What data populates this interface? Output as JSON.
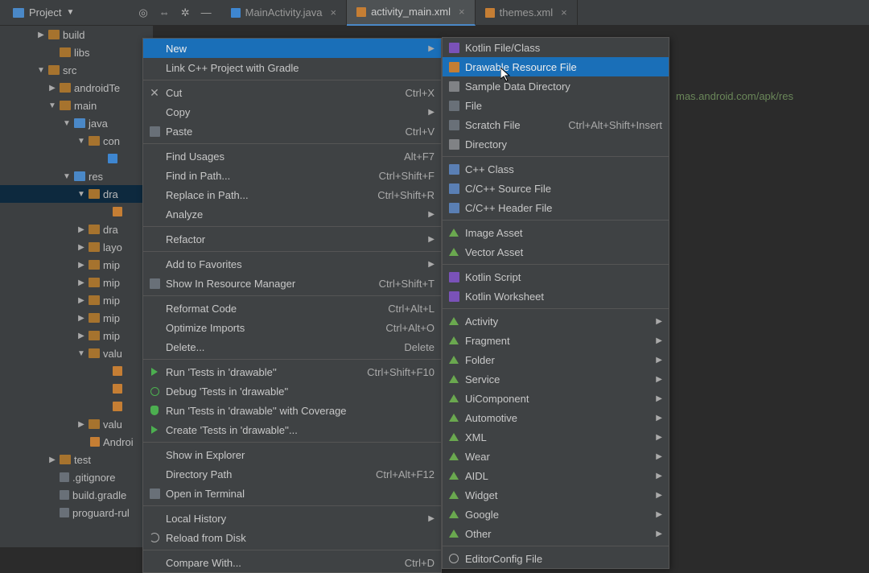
{
  "topbar": {
    "project_label": "Project",
    "tabs": [
      {
        "label": "MainActivity.java",
        "icon": "java"
      },
      {
        "label": "activity_main.xml",
        "icon": "xml",
        "active": true
      },
      {
        "label": "themes.xml",
        "icon": "xml"
      }
    ]
  },
  "tree": {
    "items": [
      {
        "label": "build",
        "indent": 46,
        "arrow": "▶",
        "icon": "folder"
      },
      {
        "label": "libs",
        "indent": 60,
        "arrow": "",
        "icon": "folder"
      },
      {
        "label": "src",
        "indent": 46,
        "arrow": "▼",
        "icon": "folder"
      },
      {
        "label": "androidTe",
        "indent": 60,
        "arrow": "▶",
        "icon": "folder"
      },
      {
        "label": "main",
        "indent": 60,
        "arrow": "▼",
        "icon": "folder"
      },
      {
        "label": "java",
        "indent": 78,
        "arrow": "▼",
        "icon": "folder-blue"
      },
      {
        "label": "con",
        "indent": 96,
        "arrow": "▼",
        "icon": "folder"
      },
      {
        "label": "",
        "indent": 120,
        "arrow": "",
        "icon": "java"
      },
      {
        "label": "res",
        "indent": 78,
        "arrow": "▼",
        "icon": "folder-blue"
      },
      {
        "label": "dra",
        "indent": 96,
        "arrow": "▼",
        "icon": "folder",
        "sel": true
      },
      {
        "label": "",
        "indent": 126,
        "arrow": "",
        "icon": "xml"
      },
      {
        "label": "dra",
        "indent": 96,
        "arrow": "▶",
        "icon": "folder"
      },
      {
        "label": "layo",
        "indent": 96,
        "arrow": "▶",
        "icon": "folder"
      },
      {
        "label": "mip",
        "indent": 96,
        "arrow": "▶",
        "icon": "folder"
      },
      {
        "label": "mip",
        "indent": 96,
        "arrow": "▶",
        "icon": "folder"
      },
      {
        "label": "mip",
        "indent": 96,
        "arrow": "▶",
        "icon": "folder"
      },
      {
        "label": "mip",
        "indent": 96,
        "arrow": "▶",
        "icon": "folder"
      },
      {
        "label": "mip",
        "indent": 96,
        "arrow": "▶",
        "icon": "folder"
      },
      {
        "label": "valu",
        "indent": 96,
        "arrow": "▼",
        "icon": "folder"
      },
      {
        "label": "",
        "indent": 126,
        "arrow": "",
        "icon": "xml"
      },
      {
        "label": "",
        "indent": 126,
        "arrow": "",
        "icon": "xml"
      },
      {
        "label": "",
        "indent": 126,
        "arrow": "",
        "icon": "xml"
      },
      {
        "label": "valu",
        "indent": 96,
        "arrow": "▶",
        "icon": "folder"
      },
      {
        "label": "Androi",
        "indent": 98,
        "arrow": "",
        "icon": "xml"
      },
      {
        "label": "test",
        "indent": 60,
        "arrow": "▶",
        "icon": "folder"
      },
      {
        "label": ".gitignore",
        "indent": 60,
        "arrow": "",
        "icon": "file"
      },
      {
        "label": "build.gradle",
        "indent": 60,
        "arrow": "",
        "icon": "file"
      },
      {
        "label": "proguard-rul",
        "indent": 60,
        "arrow": "",
        "icon": "file"
      }
    ]
  },
  "editor": {
    "bg_line": "mas.android.com/apk/res"
  },
  "menu1": {
    "items": [
      {
        "label": "New",
        "sub": true,
        "sel": true
      },
      {
        "label": "Link C++ Project with Gradle"
      },
      {
        "sep": true
      },
      {
        "label": "Cut",
        "shortcut": "Ctrl+X",
        "icon": "close"
      },
      {
        "label": "Copy",
        "sub": true
      },
      {
        "label": "Paste",
        "shortcut": "Ctrl+V",
        "icon": "file"
      },
      {
        "sep": true
      },
      {
        "label": "Find Usages",
        "shortcut": "Alt+F7"
      },
      {
        "label": "Find in Path...",
        "shortcut": "Ctrl+Shift+F"
      },
      {
        "label": "Replace in Path...",
        "shortcut": "Ctrl+Shift+R"
      },
      {
        "label": "Analyze",
        "sub": true
      },
      {
        "sep": true
      },
      {
        "label": "Refactor",
        "sub": true
      },
      {
        "sep": true
      },
      {
        "label": "Add to Favorites",
        "sub": true
      },
      {
        "label": "Show In Resource Manager",
        "shortcut": "Ctrl+Shift+T",
        "icon": "file"
      },
      {
        "sep": true
      },
      {
        "label": "Reformat Code",
        "shortcut": "Ctrl+Alt+L"
      },
      {
        "label": "Optimize Imports",
        "shortcut": "Ctrl+Alt+O"
      },
      {
        "label": "Delete...",
        "shortcut": "Delete"
      },
      {
        "sep": true
      },
      {
        "label": "Run 'Tests in 'drawable''",
        "shortcut": "Ctrl+Shift+F10",
        "icon": "run"
      },
      {
        "label": "Debug 'Tests in 'drawable''",
        "icon": "bug"
      },
      {
        "label": "Run 'Tests in 'drawable'' with Coverage",
        "icon": "shield"
      },
      {
        "label": "Create 'Tests in 'drawable''...",
        "icon": "run"
      },
      {
        "sep": true
      },
      {
        "label": "Show in Explorer"
      },
      {
        "label": "Directory Path",
        "shortcut": "Ctrl+Alt+F12"
      },
      {
        "label": "Open in Terminal",
        "icon": "file"
      },
      {
        "sep": true
      },
      {
        "label": "Local History",
        "sub": true
      },
      {
        "label": "Reload from Disk",
        "icon": "refresh"
      },
      {
        "sep": true
      },
      {
        "label": "Compare With...",
        "shortcut": "Ctrl+D"
      }
    ]
  },
  "menu2": {
    "items": [
      {
        "label": "Kotlin File/Class",
        "icon": "k"
      },
      {
        "label": "Drawable Resource File",
        "icon": "xml",
        "sel": true
      },
      {
        "label": "Sample Data Directory",
        "icon": "fold"
      },
      {
        "label": "File",
        "icon": "file"
      },
      {
        "label": "Scratch File",
        "shortcut": "Ctrl+Alt+Shift+Insert",
        "icon": "file"
      },
      {
        "label": "Directory",
        "icon": "fold"
      },
      {
        "sep": true
      },
      {
        "label": "C++ Class",
        "icon": "cpp"
      },
      {
        "label": "C/C++ Source File",
        "icon": "cpp"
      },
      {
        "label": "C/C++ Header File",
        "icon": "cpp"
      },
      {
        "sep": true
      },
      {
        "label": "Image Asset",
        "icon": "green-tri"
      },
      {
        "label": "Vector Asset",
        "icon": "green-tri"
      },
      {
        "sep": true
      },
      {
        "label": "Kotlin Script",
        "icon": "k"
      },
      {
        "label": "Kotlin Worksheet",
        "icon": "k"
      },
      {
        "sep": true
      },
      {
        "label": "Activity",
        "sub": true,
        "icon": "green-tri"
      },
      {
        "label": "Fragment",
        "sub": true,
        "icon": "green-tri"
      },
      {
        "label": "Folder",
        "sub": true,
        "icon": "green-tri"
      },
      {
        "label": "Service",
        "sub": true,
        "icon": "green-tri"
      },
      {
        "label": "UiComponent",
        "sub": true,
        "icon": "green-tri"
      },
      {
        "label": "Automotive",
        "sub": true,
        "icon": "green-tri"
      },
      {
        "label": "XML",
        "sub": true,
        "icon": "green-tri"
      },
      {
        "label": "Wear",
        "sub": true,
        "icon": "green-tri"
      },
      {
        "label": "AIDL",
        "sub": true,
        "icon": "green-tri"
      },
      {
        "label": "Widget",
        "sub": true,
        "icon": "green-tri"
      },
      {
        "label": "Google",
        "sub": true,
        "icon": "green-tri"
      },
      {
        "label": "Other",
        "sub": true,
        "icon": "green-tri"
      },
      {
        "sep": true
      },
      {
        "label": "EditorConfig File",
        "icon": "gear"
      }
    ]
  }
}
